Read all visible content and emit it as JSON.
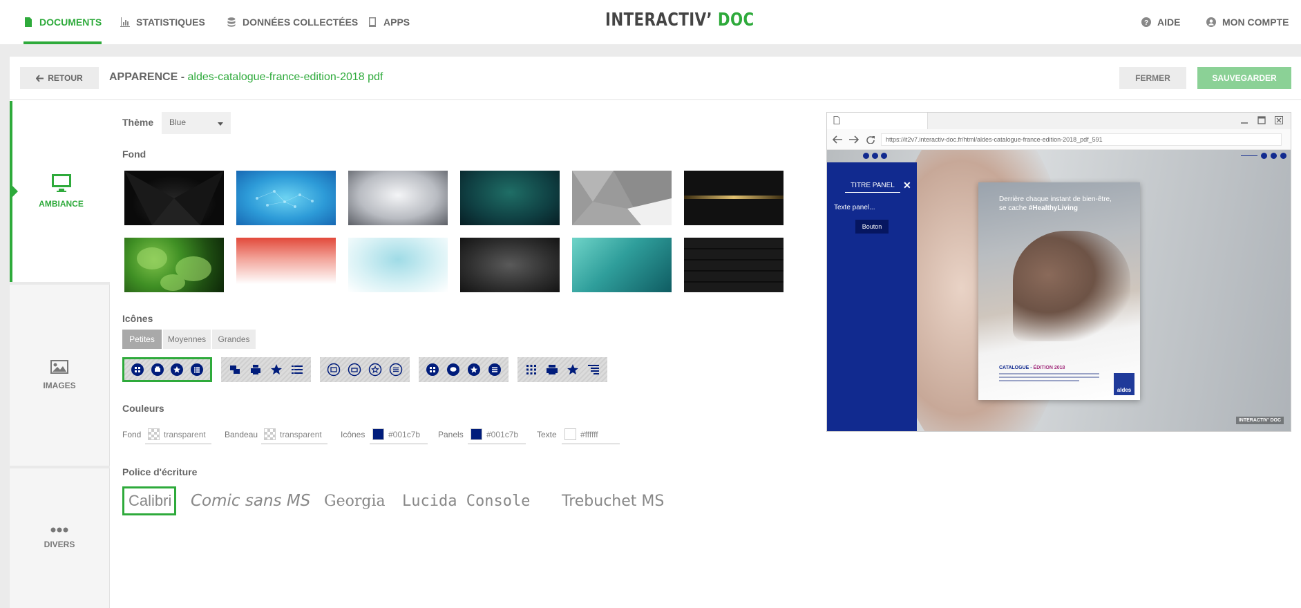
{
  "nav": {
    "items": [
      {
        "label": "DOCUMENTS",
        "icon": "file-icon",
        "active": true
      },
      {
        "label": "STATISTIQUES",
        "icon": "bar-chart-icon",
        "active": false
      },
      {
        "label": "DONNÉES COLLECTÉES",
        "icon": "database-icon",
        "active": false
      },
      {
        "label": "APPS",
        "icon": "tablet-icon",
        "active": false
      }
    ],
    "brand_main": "INTERACTIV’",
    "brand_accent": "DOC",
    "help": "AIDE",
    "account": "MON COMPTE"
  },
  "header": {
    "back": "RETOUR",
    "title_prefix": "APPARENCE -",
    "filename": "aldes-catalogue-france-edition-2018 pdf",
    "close": "FERMER",
    "save": "SAUVEGARDER"
  },
  "side_tabs": [
    {
      "label": "AMBIANCE",
      "icon": "monitor-icon",
      "active": true
    },
    {
      "label": "IMAGES",
      "icon": "image-icon",
      "active": false
    },
    {
      "label": "DIVERS",
      "icon": "more-icon",
      "active": false
    }
  ],
  "theme": {
    "label": "Thème",
    "value": "Blue"
  },
  "fond": {
    "label": "Fond",
    "backgrounds": [
      "black-abstract",
      "blue-network",
      "grey-gradient",
      "dark-green-texture",
      "grey-geometric",
      "black-gold-stripe",
      "green-leaves",
      "red-fade",
      "light-blue-watercolor",
      "dark-grey-texture",
      "turquoise-sea",
      "black-brick"
    ]
  },
  "icones": {
    "label": "Icônes",
    "sizes": [
      "Petites",
      "Moyennes",
      "Grandes"
    ],
    "active_size": "Petites"
  },
  "couleurs": {
    "label": "Couleurs",
    "fields": [
      {
        "label": "Fond",
        "value": "transparent"
      },
      {
        "label": "Bandeau",
        "value": "transparent"
      },
      {
        "label": "Icônes",
        "value": "#001c7b"
      },
      {
        "label": "Panels",
        "value": "#001c7b"
      },
      {
        "label": "Texte",
        "value": "#ffffff"
      }
    ]
  },
  "police": {
    "label": "Police d'écriture",
    "options": [
      "Calibri",
      "Comic sans MS",
      "Georgia",
      "Lucida Console",
      "Trebuchet MS"
    ],
    "active": "Calibri"
  },
  "preview": {
    "url": "https://it2v7.interactiv-doc.fr/html/aldes-catalogue-france-edition-2018_pdf_591",
    "panel_title": "TITRE PANEL",
    "panel_text": "Texte panel...",
    "panel_button": "Bouton",
    "logo_text": "aldes",
    "hero_line": "Derrière chaque instant de bien-être,",
    "hero_line2": "se cache",
    "hero_hash": "#HealthyLiving",
    "catalog_label": "CATALOGUE -",
    "catalog_edition": "ÉDITION 2018",
    "catalog_logo": "aldes",
    "watermark": "INTERACTIV' DOC"
  },
  "colors": {
    "accent": "#2eaa3b",
    "panel_blue": "#001c7b"
  }
}
